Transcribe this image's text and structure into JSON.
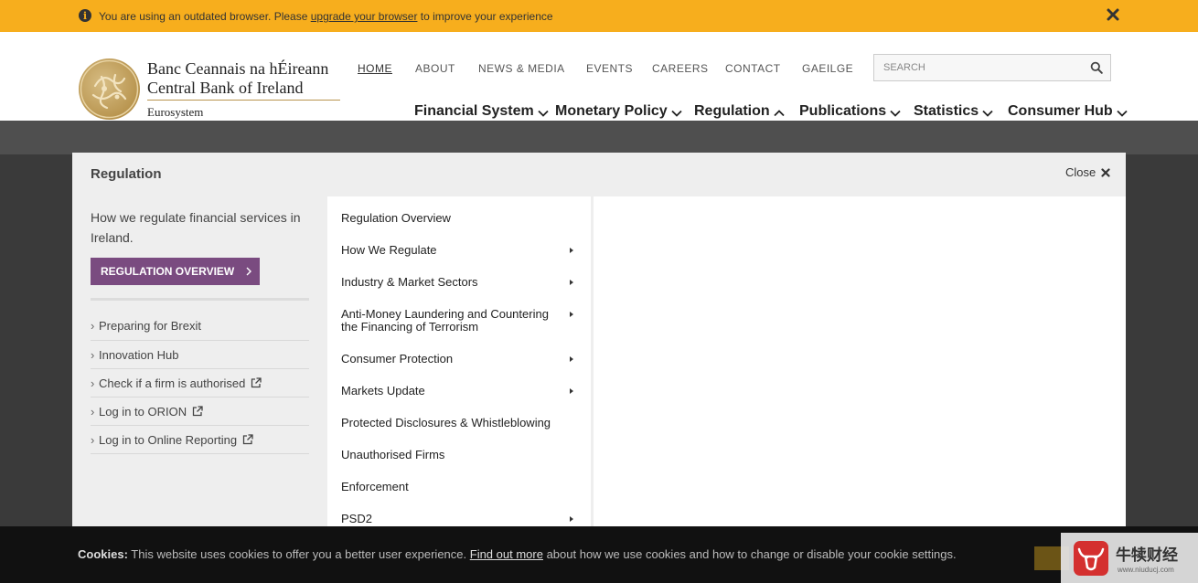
{
  "alert": {
    "text_before": "You are using an outdated browser. Please ",
    "link": "upgrade your browser",
    "text_after": " to improve your experience"
  },
  "logo": {
    "line1": "Banc Ceannais na hÉireann",
    "line2": "Central Bank of Ireland",
    "line3": "Eurosystem"
  },
  "top_nav": [
    "HOME",
    "ABOUT",
    "NEWS & MEDIA",
    "EVENTS",
    "CAREERS",
    "CONTACT",
    "GAEILGE"
  ],
  "search": {
    "placeholder": "SEARCH"
  },
  "main_nav": [
    "Financial System",
    "Monetary Policy",
    "Regulation",
    "Publications",
    "Statistics",
    "Consumer Hub"
  ],
  "mega": {
    "title": "Regulation",
    "close_label": "Close",
    "description": "How we regulate financial services in Ireland.",
    "overview_button": "REGULATION OVERVIEW",
    "left_links": [
      "Preparing for Brexit",
      "Innovation Hub",
      "Check if a firm is authorised",
      "Log in to ORION",
      "Log in to Online Reporting"
    ],
    "menu_items": [
      "Regulation Overview",
      "How We Regulate",
      "Industry & Market Sectors",
      "Anti-Money Laundering and Countering the Financing of Terrorism",
      "Consumer Protection",
      "Markets Update",
      "Protected Disclosures & Whistleblowing",
      "Unauthorised Firms",
      "Enforcement",
      "PSD2"
    ]
  },
  "cookie": {
    "label": "Cookies:",
    "text1": " This website uses cookies to offer you a better user experience. ",
    "link": "Find out more",
    "text2": " about how we use cookies and how to change or disable your cookie settings."
  },
  "watermark": {
    "text": "牛犊财经",
    "url": "www.niuducj.com"
  },
  "colors": {
    "alert": "#f7ae1d",
    "button": "#7a4b80",
    "gold": "#b8944e"
  }
}
